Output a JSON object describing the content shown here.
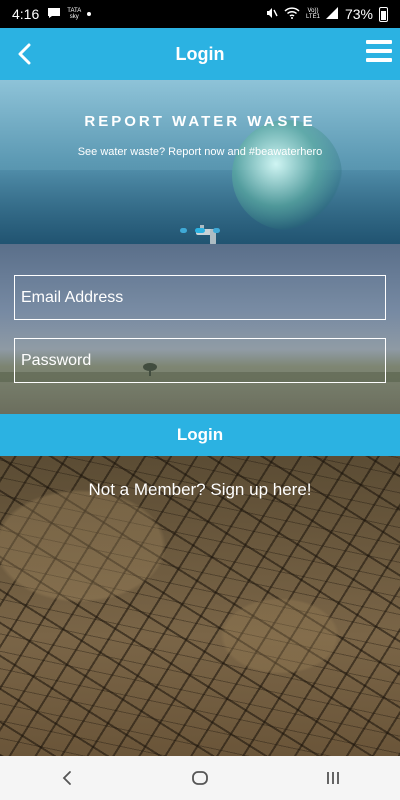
{
  "status_bar": {
    "time": "4:16",
    "carrier": "TATA sky",
    "network": "Vo)) LTE1",
    "battery": "73%"
  },
  "app_bar": {
    "title": "Login",
    "back_icon": "chevron-left-icon",
    "menu_icon": "hamburger-menu-icon",
    "color": "#2bb2e2"
  },
  "banner": {
    "headline": "REPORT WATER WASTE",
    "subtitle": "See water waste? Report now and #beawaterhero",
    "slide_index": 2,
    "slide_count": 3
  },
  "form": {
    "email_placeholder": "Email Address",
    "password_placeholder": "Password",
    "login_label": "Login"
  },
  "signup": {
    "text": "Not a Member? Sign up here!"
  },
  "nav_bar": {
    "back_icon": "nav-back-icon",
    "home_icon": "nav-home-icon",
    "recents_icon": "nav-recents-icon"
  }
}
